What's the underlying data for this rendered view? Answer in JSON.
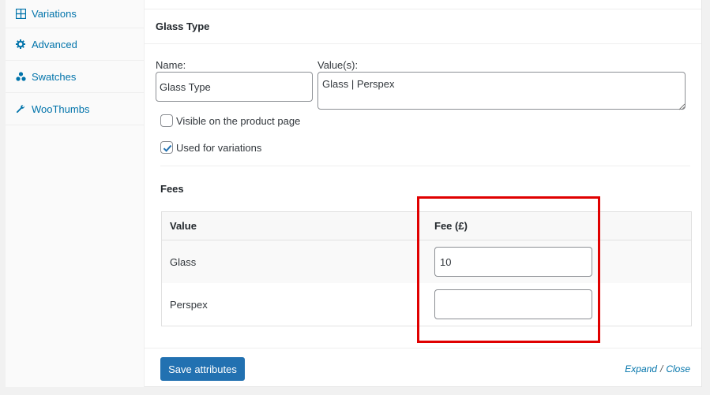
{
  "sidebar": {
    "items": [
      {
        "label": "Variations",
        "icon": "grid-icon"
      },
      {
        "label": "Advanced",
        "icon": "gear-icon"
      },
      {
        "label": "Swatches",
        "icon": "dots-icon"
      },
      {
        "label": "WooThumbs",
        "icon": "wrench-icon"
      }
    ]
  },
  "attribute": {
    "header_title": "Glass Type",
    "name_label": "Name:",
    "name_value": "Glass Type",
    "values_label": "Value(s):",
    "values_value": "Glass | Perspex",
    "visible_label": "Visible on the product page",
    "visible_checked": false,
    "variations_label": "Used for variations",
    "variations_checked": true
  },
  "fees": {
    "title": "Fees",
    "columns": {
      "value": "Value",
      "fee": "Fee (£)"
    },
    "rows": [
      {
        "value": "Glass",
        "fee": "10"
      },
      {
        "value": "Perspex",
        "fee": ""
      }
    ]
  },
  "footer": {
    "save_label": "Save attributes",
    "expand_label": "Expand",
    "separator": "/",
    "close_label": "Close"
  },
  "colors": {
    "link": "#0073aa",
    "primary_button": "#2271b1",
    "highlight": "#e00000"
  }
}
